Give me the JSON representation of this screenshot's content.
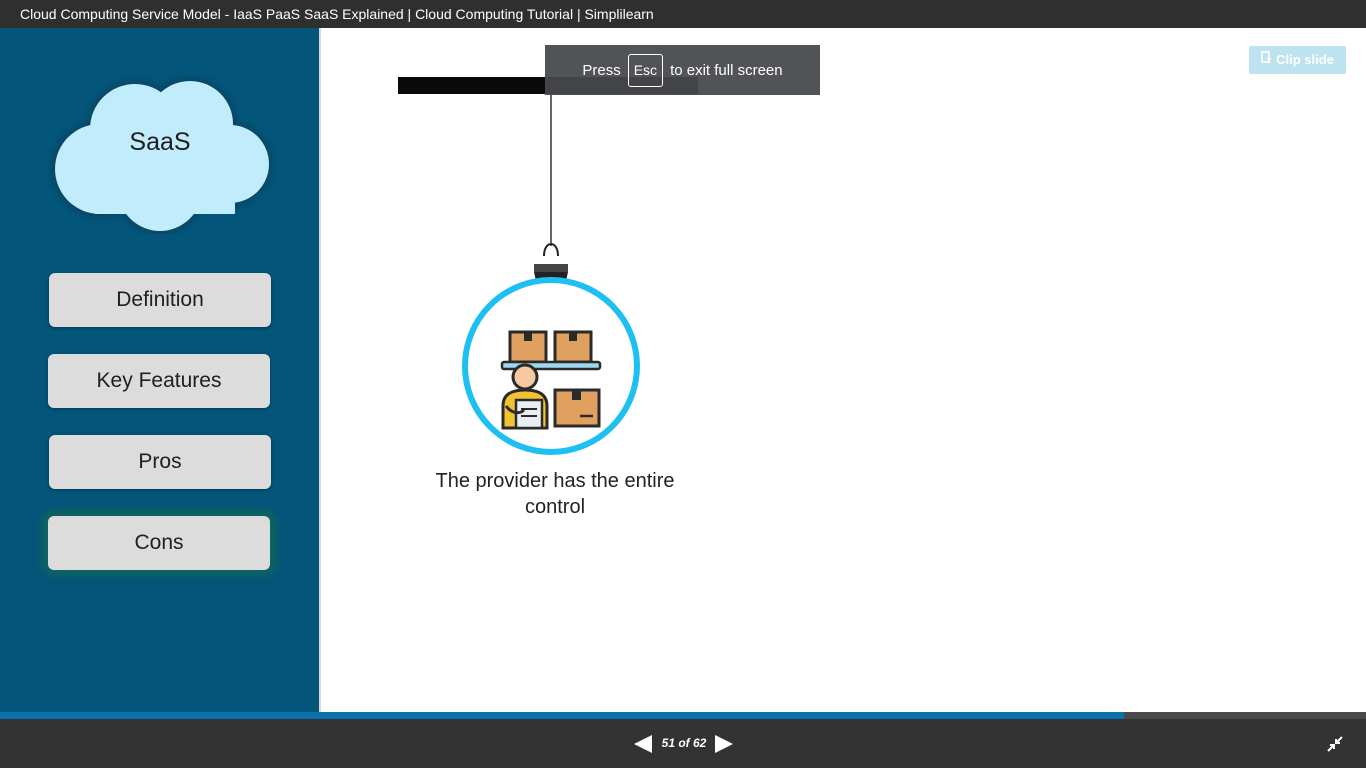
{
  "window": {
    "title": "Cloud Computing Service Model - IaaS PaaS SaaS Explained | Cloud Computing Tutorial | Simplilearn"
  },
  "sidebar": {
    "cloud_label": "SaaS",
    "items": [
      {
        "label": "Definition",
        "active": false
      },
      {
        "label": "Key Features",
        "active": false
      },
      {
        "label": "Pros",
        "active": false
      },
      {
        "label": "Cons",
        "active": true
      }
    ]
  },
  "fullscreen_notice": {
    "prefix": "Press",
    "key": "Esc",
    "suffix": "to exit full screen"
  },
  "clip_slide": {
    "label": "Clip slide",
    "icon": "clip-icon"
  },
  "content": {
    "caption": "The provider has the entire control",
    "illustration_icon": "warehouse-worker-icon"
  },
  "player": {
    "current_slide": 51,
    "total_slides": 62,
    "page_label": "51 of 62",
    "progress_fraction": 0.823,
    "prev_icon": "triangle-left-icon",
    "next_icon": "triangle-right-icon",
    "exit_fullscreen_icon": "exit-fullscreen-icon"
  },
  "colors": {
    "sidebar_bg": "#03557a",
    "cloud_fill": "#c1ecfb",
    "ring": "#1dc0f0",
    "progress": "#0b72ad",
    "box": "#e0a060",
    "active_glow": "#146e50"
  }
}
